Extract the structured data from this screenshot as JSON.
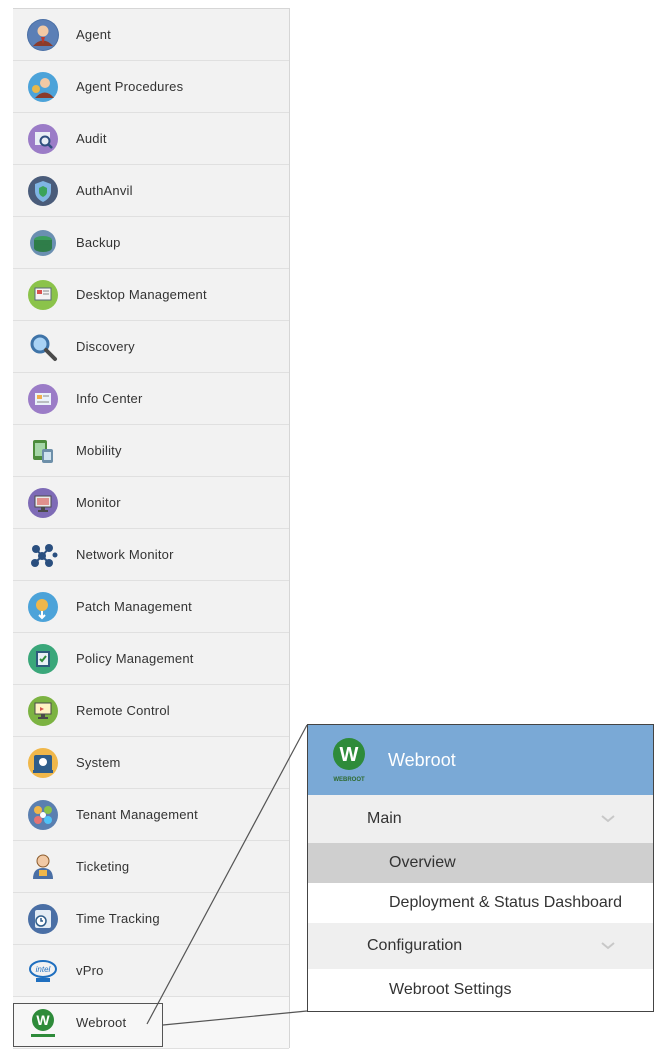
{
  "modules": [
    {
      "label": "Agent",
      "icon": "agent-icon"
    },
    {
      "label": "Agent Procedures",
      "icon": "agent-procedures-icon"
    },
    {
      "label": "Audit",
      "icon": "audit-icon"
    },
    {
      "label": "AuthAnvil",
      "icon": "authanvil-shield-icon"
    },
    {
      "label": "Backup",
      "icon": "backup-icon"
    },
    {
      "label": "Desktop Management",
      "icon": "desktop-management-icon"
    },
    {
      "label": "Discovery",
      "icon": "magnifier-icon"
    },
    {
      "label": "Info Center",
      "icon": "info-center-icon"
    },
    {
      "label": "Mobility",
      "icon": "mobility-icon"
    },
    {
      "label": "Monitor",
      "icon": "monitor-icon"
    },
    {
      "label": "Network Monitor",
      "icon": "network-monitor-icon"
    },
    {
      "label": "Patch Management",
      "icon": "patch-management-icon"
    },
    {
      "label": "Policy Management",
      "icon": "policy-management-icon"
    },
    {
      "label": "Remote Control",
      "icon": "remote-control-icon"
    },
    {
      "label": "System",
      "icon": "system-icon"
    },
    {
      "label": "Tenant Management",
      "icon": "tenant-management-icon"
    },
    {
      "label": "Ticketing",
      "icon": "ticketing-person-icon"
    },
    {
      "label": "Time Tracking",
      "icon": "time-tracking-icon"
    },
    {
      "label": "vPro",
      "icon": "intel-vpro-icon"
    },
    {
      "label": "Webroot",
      "icon": "webroot-logo-icon"
    }
  ],
  "panel": {
    "title": "Webroot",
    "logo_text": "WEBROOT",
    "sections": [
      {
        "label": "Main",
        "items": [
          "Overview",
          "Deployment & Status Dashboard"
        ]
      },
      {
        "label": "Configuration",
        "items": [
          "Webroot Settings"
        ]
      }
    ],
    "selected_item": "Overview"
  },
  "colors": {
    "panel_header": "#7aa9d6",
    "selected_row": "#cfcfcf",
    "list_background": "#f2f2f2",
    "webroot_green": "#2e8b3a"
  }
}
